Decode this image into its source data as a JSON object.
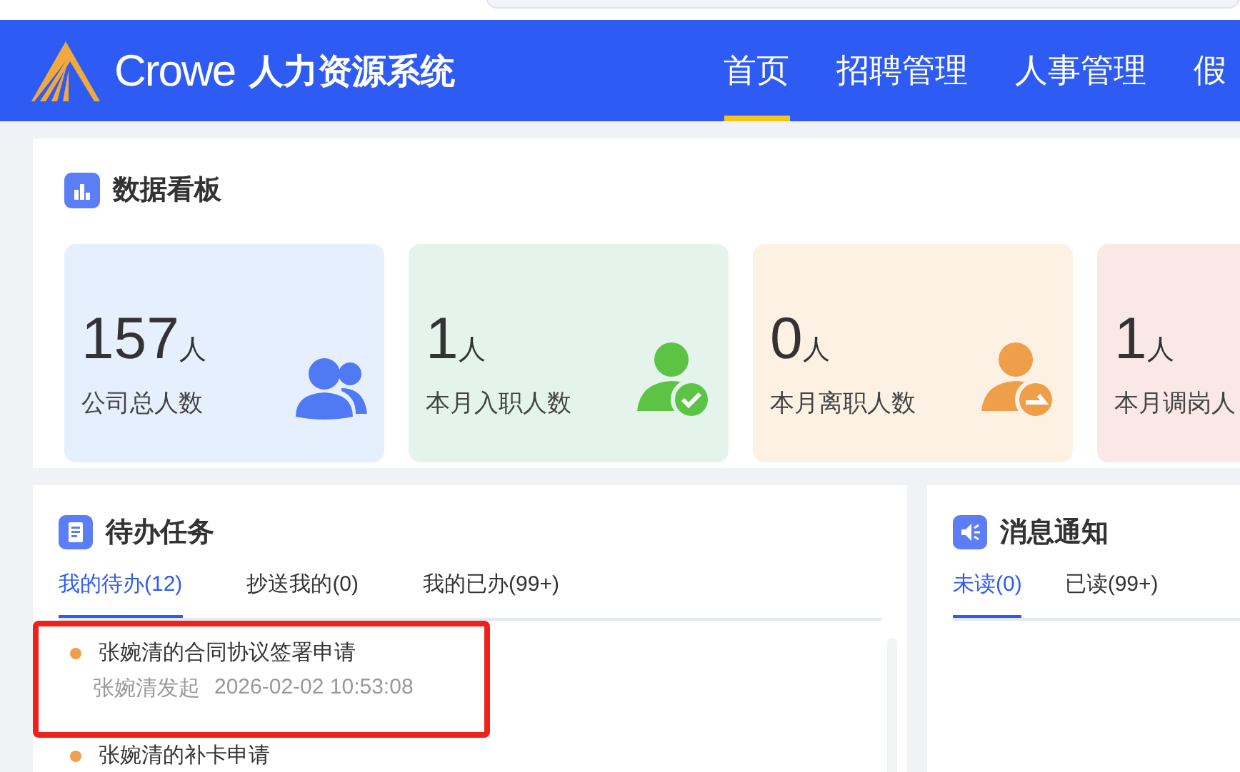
{
  "header": {
    "brand": "Crowe",
    "system_name": "人力资源系统",
    "nav": [
      {
        "label": "首页",
        "selected": true
      },
      {
        "label": "招聘管理",
        "selected": false
      },
      {
        "label": "人事管理",
        "selected": false
      },
      {
        "label": "假",
        "selected": false
      }
    ]
  },
  "dashboard": {
    "title": "数据看板",
    "cards": [
      {
        "value": "157",
        "unit": "人",
        "label": "公司总人数",
        "color": "#e6effd",
        "kind": "group"
      },
      {
        "value": "1",
        "unit": "人",
        "label": "本月入职人数",
        "color": "#e4f4ed",
        "kind": "joined"
      },
      {
        "value": "0",
        "unit": "人",
        "label": "本月离职人数",
        "color": "#fdf1e4",
        "kind": "left"
      },
      {
        "value": "1",
        "unit": "人",
        "label": "本月调岗人",
        "color": "#f9e8e5",
        "kind": "none"
      }
    ]
  },
  "tasks": {
    "title": "待办任务",
    "tabs": [
      {
        "label": "我的待办(12)",
        "selected": true
      },
      {
        "label": "抄送我的(0)",
        "selected": false
      },
      {
        "label": "我的已办(99+)",
        "selected": false
      }
    ],
    "items": [
      {
        "title": "张婉清的合同协议签署申请",
        "initiator": "张婉清发起",
        "time": "2026-02-02 10:53:08",
        "highlighted": true
      },
      {
        "title": "张婉清的补卡申请",
        "highlighted": false
      }
    ]
  },
  "notices": {
    "title": "消息通知",
    "tabs": [
      {
        "label": "未读(0)",
        "selected": true
      },
      {
        "label": "已读(99+)",
        "selected": false
      }
    ]
  }
}
